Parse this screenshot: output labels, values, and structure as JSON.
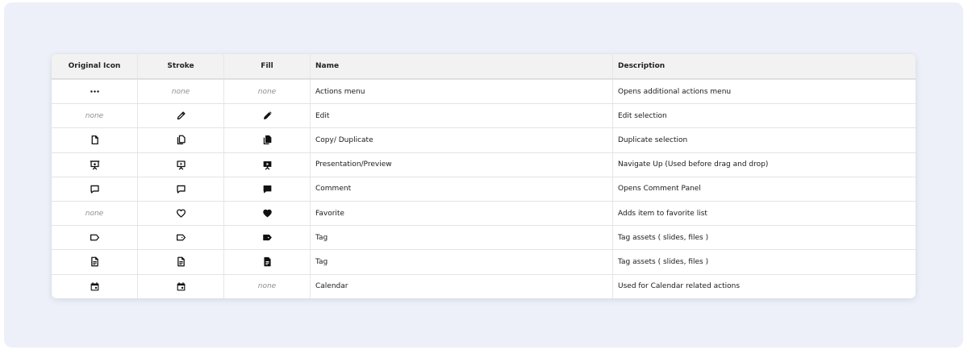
{
  "headers": {
    "original": "Original Icon",
    "stroke": "Stroke",
    "fill": "Fill",
    "name": "Name",
    "description": "Description"
  },
  "none_label": "none",
  "rows": [
    {
      "original_icon": "more-horizontal-icon",
      "stroke_icon": null,
      "fill_icon": null,
      "name": "Actions menu",
      "description": "Opens additional actions menu"
    },
    {
      "original_icon": null,
      "stroke_icon": "pencil-icon",
      "fill_icon": "pencil-icon",
      "name": "Edit",
      "description": "Edit selection"
    },
    {
      "original_icon": "file-icon",
      "stroke_icon": "copy-icon",
      "fill_icon": "copy-icon",
      "name": "Copy/ Duplicate",
      "description": "Duplicate selection"
    },
    {
      "original_icon": "presentation-icon",
      "stroke_icon": "presentation-play-icon",
      "fill_icon": "presentation-play-icon",
      "name": "Presentation/Preview",
      "description": "Navigate Up (Used before drag and drop)"
    },
    {
      "original_icon": "comment-icon",
      "stroke_icon": "comment-icon",
      "fill_icon": "comment-icon",
      "name": "Comment",
      "description": "Opens Comment Panel"
    },
    {
      "original_icon": null,
      "stroke_icon": "heart-icon",
      "fill_icon": "heart-icon",
      "name": "Favorite",
      "description": "Adds item to favorite list"
    },
    {
      "original_icon": "tag-icon",
      "stroke_icon": "tag-icon",
      "fill_icon": "tag-icon",
      "name": "Tag",
      "description": "Tag assets ( slides, files )"
    },
    {
      "original_icon": "document-icon",
      "stroke_icon": "document-icon",
      "fill_icon": "document-icon",
      "name": "Tag",
      "description": "Tag assets ( slides, files )"
    },
    {
      "original_icon": "calendar-icon",
      "stroke_icon": "calendar-icon",
      "fill_icon": null,
      "name": "Calendar",
      "description": "Used for Calendar related actions"
    }
  ]
}
